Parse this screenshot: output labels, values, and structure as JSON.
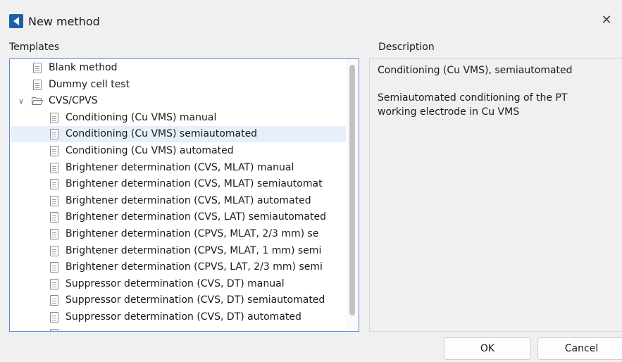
{
  "window": {
    "title": "New method",
    "close_glyph": "✕"
  },
  "templates": {
    "label": "Templates",
    "items": [
      {
        "label": "Blank method",
        "level": 0,
        "icon": "document-icon",
        "selected": false
      },
      {
        "label": "Dummy cell test",
        "level": 0,
        "icon": "document-icon",
        "selected": false
      },
      {
        "label": "CVS/CPVS",
        "level": 0,
        "icon": "folder-open-icon",
        "expanded": true,
        "selected": false
      },
      {
        "label": "Conditioning (Cu VMS) manual",
        "level": 1,
        "icon": "document-icon",
        "selected": false
      },
      {
        "label": "Conditioning (Cu VMS) semiautomated",
        "level": 1,
        "icon": "document-icon",
        "selected": true
      },
      {
        "label": "Conditioning (Cu VMS) automated",
        "level": 1,
        "icon": "document-icon",
        "selected": false
      },
      {
        "label": "Brightener determination (CVS, MLAT) manual",
        "level": 1,
        "icon": "document-icon",
        "selected": false
      },
      {
        "label": "Brightener determination (CVS, MLAT) semiautomat",
        "level": 1,
        "icon": "document-icon",
        "selected": false
      },
      {
        "label": "Brightener determination (CVS, MLAT) automated",
        "level": 1,
        "icon": "document-icon",
        "selected": false
      },
      {
        "label": "Brightener determination (CVS, LAT) semiautomated",
        "level": 1,
        "icon": "document-icon",
        "selected": false
      },
      {
        "label": "Brightener determination (CPVS, MLAT, 2/3 mm) se",
        "level": 1,
        "icon": "document-icon",
        "selected": false
      },
      {
        "label": "Brightener determination (CPVS, MLAT, 1 mm) semi",
        "level": 1,
        "icon": "document-icon",
        "selected": false
      },
      {
        "label": "Brightener determination (CPVS, LAT, 2/3 mm) semi",
        "level": 1,
        "icon": "document-icon",
        "selected": false
      },
      {
        "label": "Suppressor determination (CVS, DT) manual",
        "level": 1,
        "icon": "document-icon",
        "selected": false
      },
      {
        "label": "Suppressor determination (CVS, DT) semiautomated",
        "level": 1,
        "icon": "document-icon",
        "selected": false
      },
      {
        "label": "Suppressor determination (CVS, DT) automated",
        "level": 1,
        "icon": "document-icon",
        "selected": false
      },
      {
        "label": "",
        "level": 1,
        "icon": "document-icon",
        "selected": false
      }
    ]
  },
  "description": {
    "label": "Description",
    "title": "Conditioning (Cu VMS), semiautomated",
    "text": "Semiautomated conditioning of the PT working electrode in Cu VMS"
  },
  "buttons": {
    "ok": "OK",
    "cancel": "Cancel"
  },
  "colors": {
    "selection": "#e5f0fb",
    "focus_border": "#5b8fd6",
    "app_icon": "#1f5fa8"
  }
}
